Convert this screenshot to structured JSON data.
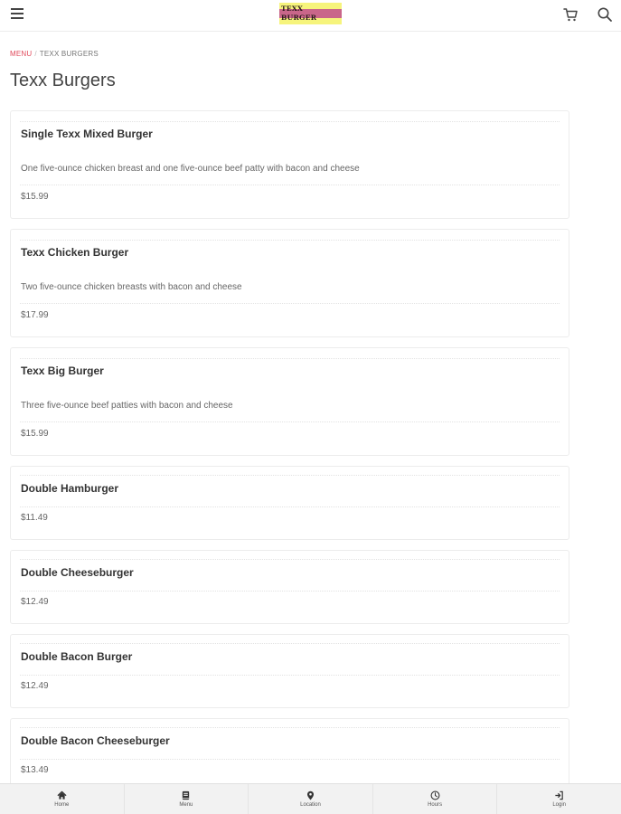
{
  "header": {
    "logo_text": "TEXX BURGER",
    "logo_colors": {
      "background": "#f6f47c",
      "band": "#c9668a"
    }
  },
  "breadcrumb": {
    "root": "MENU",
    "separator": "/",
    "current": "TEXX BURGERS"
  },
  "page": {
    "title": "Texx Burgers"
  },
  "items": [
    {
      "name": "Single Texx Mixed Burger",
      "description": "One five-ounce chicken breast and one five-ounce beef patty with bacon and cheese",
      "price": "$15.99"
    },
    {
      "name": "Texx Chicken Burger",
      "description": "Two five-ounce chicken breasts with bacon and cheese",
      "price": "$17.99"
    },
    {
      "name": "Texx Big Burger",
      "description": "Three five-ounce beef patties with bacon and cheese",
      "price": "$15.99"
    },
    {
      "name": "Double Hamburger",
      "price": "$11.49"
    },
    {
      "name": "Double Cheeseburger",
      "price": "$12.49"
    },
    {
      "name": "Double Bacon Burger",
      "price": "$12.49"
    },
    {
      "name": "Double Bacon Cheeseburger",
      "price": "$13.49"
    }
  ],
  "bottom_nav": {
    "tabs": [
      {
        "label": "Home",
        "icon": "home-icon"
      },
      {
        "label": "Menu",
        "icon": "book-icon"
      },
      {
        "label": "Location",
        "icon": "map-pin-icon"
      },
      {
        "label": "Hours",
        "icon": "clock-icon"
      },
      {
        "label": "Login",
        "icon": "sign-in-icon"
      }
    ]
  },
  "colors": {
    "accent": "#e0485a",
    "text": "#333333",
    "muted": "#666666",
    "nav_background": "#f2f2f2"
  }
}
